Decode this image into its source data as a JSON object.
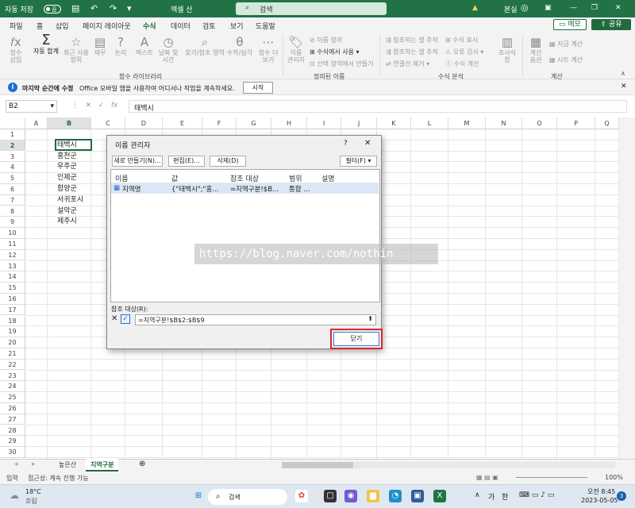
{
  "titlebar": {
    "autosave_label": "자동 저장",
    "autosave_state": "끔",
    "app_title": "엑셀 산",
    "search_label": "검색",
    "user_name": "본실"
  },
  "tabs": [
    "파일",
    "홈",
    "삽입",
    "페이지 레이아웃",
    "수식",
    "데이터",
    "검토",
    "보기",
    "도움말"
  ],
  "tabs_active": "수식",
  "memo_label": "메모",
  "share_label": "공유",
  "ribbon": {
    "fx_insert": "함수\n삽입",
    "autosum": "자동 합계",
    "recent": "최근 사용\n항목",
    "finance": "재무",
    "logic": "논리",
    "text": "텍스트",
    "datetime": "날짜 및\n시간",
    "lookup": "찾기/참조 영역",
    "math": "수학/삼각",
    "more": "함수 더\n보기",
    "name_mgr": "이름\n관리자",
    "define_name": "이름 정의",
    "use_in_formula": "수식에서 사용",
    "create_from_sel": "선택 영역에서 만들기",
    "trace_prec": "참조되는 셀 추적",
    "trace_dep": "참조하는 셀 추적",
    "remove_arrows": "연결선 제거",
    "show_formulas": "수식 표시",
    "error_check": "오류 검사",
    "eval_formula": "수식 계산",
    "watch": "조사식\n창",
    "calc_opts": "계산\n옵션",
    "calc_now": "지금 계산",
    "calc_sheet": "시트 계산",
    "group_lib": "함수 라이브러리",
    "group_names": "정의된 이름",
    "group_audit": "수식 분석",
    "group_calc": "계산"
  },
  "infobar": {
    "bold": "마지막 순간에 수정",
    "text": "Office 모바일 앱을 사용하여 어디서나 작업을 계속하세요.",
    "button": "시작"
  },
  "namebox": "B2",
  "formula": "태백시",
  "fx": "fx",
  "columns": [
    "A",
    "B",
    "C",
    "D",
    "E",
    "F",
    "G",
    "H",
    "I",
    "J",
    "K",
    "L",
    "M",
    "N",
    "O",
    "P",
    "Q"
  ],
  "rows": [
    "1",
    "2",
    "3",
    "4",
    "5",
    "6",
    "7",
    "8",
    "9",
    "10",
    "11",
    "12",
    "13",
    "14",
    "15",
    "16",
    "17",
    "18",
    "19",
    "20",
    "21",
    "22",
    "23",
    "24",
    "25",
    "26",
    "27",
    "28",
    "29",
    "30"
  ],
  "cells_b": [
    "태백시",
    "홍천군",
    "우주군",
    "인제군",
    "함양군",
    "서귀포시",
    "설악군",
    "제주시"
  ],
  "sheets": [
    "높은산",
    "지역구분"
  ],
  "sheet_active": "지역구분",
  "status": {
    "mode": "입력",
    "accessibility": "접근성: 계속 진행 가능",
    "zoom": "100%"
  },
  "dialog": {
    "title": "이름 관리자",
    "help": "?",
    "close": "✕",
    "new": "새로 만들기(N)...",
    "edit": "편집(E)...",
    "delete": "삭제(D)",
    "filter": "필터(F) ▾",
    "headers": [
      "이름",
      "값",
      "참조 대상",
      "범위",
      "설명"
    ],
    "row": {
      "name": "지역명",
      "value": "{\"태백시\";\"홍...",
      "ref": "=지역구분!$B...",
      "scope": "통합 ...",
      "desc": ""
    },
    "ref_label": "참조 대상(R):",
    "ref_value": "=지역구분!$B$2:$B$9",
    "close_btn": "닫기"
  },
  "watermark": "https://blog.naver.com/nothin",
  "taskbar": {
    "temp": "18°C",
    "weather": "흐림",
    "search": "검색",
    "ime1": "가",
    "ime2": "한",
    "time": "오전 8:45",
    "date": "2023-05-05",
    "badge": "3"
  }
}
